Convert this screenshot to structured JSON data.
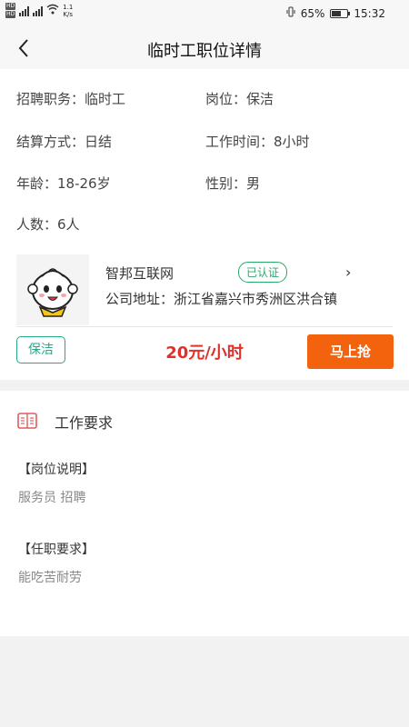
{
  "status_bar": {
    "network_speed": "1.1",
    "network_unit": "K/s",
    "battery_percent": "65%",
    "battery_level": 0.65,
    "time": "15:32"
  },
  "nav": {
    "title": "临时工职位详情"
  },
  "job_info": {
    "position": "招聘职务：临时工",
    "post": "岗位：保洁",
    "settlement": "结算方式：日结",
    "work_time": "工作时间：8小时",
    "age": "年龄：18-26岁",
    "gender": "性别：男",
    "headcount": "人数：6人"
  },
  "company": {
    "name": "智邦互联网",
    "verified_label": "已认证",
    "address": "公司地址：浙江省嘉兴市秀洲区洪合镇"
  },
  "job_bar": {
    "tag": "保洁",
    "salary": "20元/小时",
    "button_label": "马上抢"
  },
  "requirements": {
    "title": "工作要求",
    "post_desc_heading": "【岗位说明】",
    "post_desc_body": "服务员 招聘",
    "qualification_heading": "【任职要求】",
    "qualification_body": "能吃苦耐劳"
  },
  "colors": {
    "accent_orange": "#f3620c",
    "salary_red": "#e0302a",
    "tag_green": "#25a98a",
    "verified_green": "#2aa86a",
    "req_icon_red": "#e25c5c"
  },
  "icons": {
    "back": "back-chevron-icon",
    "requirements": "book-icon",
    "company_logo": "bun-mascot-logo"
  }
}
